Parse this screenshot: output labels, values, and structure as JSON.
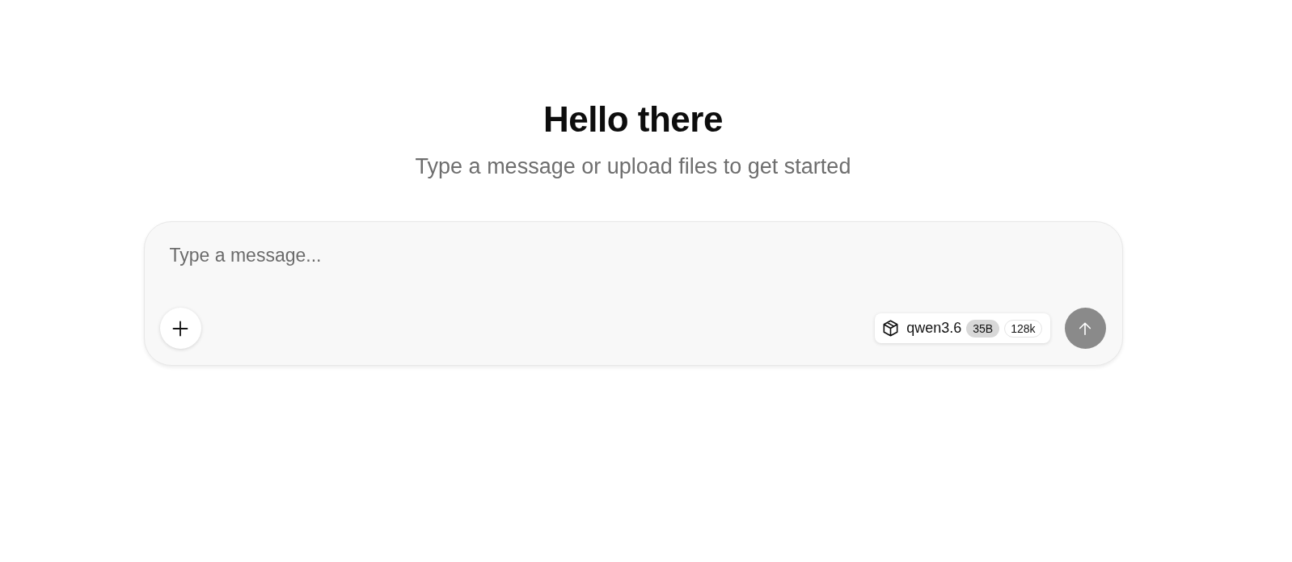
{
  "heading": {
    "title": "Hello there",
    "subtitle": "Type a message or upload files to get started"
  },
  "composer": {
    "placeholder": "Type a message...",
    "model": {
      "name": "qwen3.6",
      "badges": [
        {
          "label": "35B",
          "kind": "filled"
        },
        {
          "label": "128k",
          "kind": "outlined"
        }
      ]
    },
    "send_button": {
      "disabled": true
    }
  }
}
